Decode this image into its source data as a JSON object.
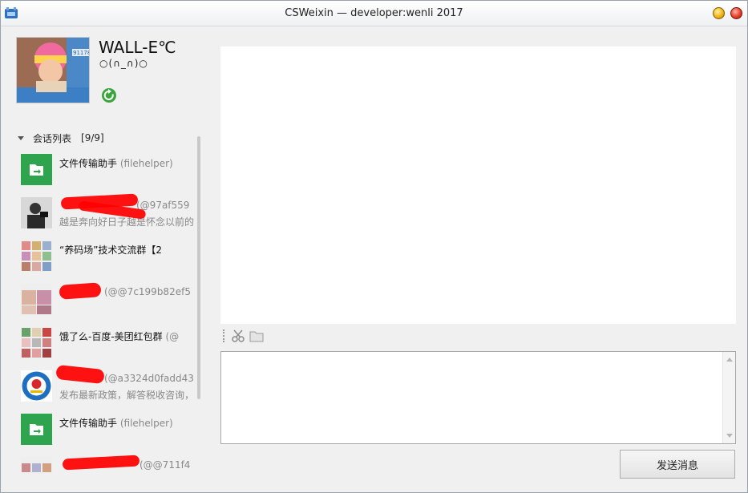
{
  "window": {
    "title": "CSWeixin — developer:wenli 2017",
    "icon": "app-logo-icon"
  },
  "profile": {
    "nickname": "WALL-E℃",
    "signature": "○(∩_∩)○",
    "avatar_text": "911787",
    "refresh_icon": "refresh-icon"
  },
  "session_list": {
    "label": "会话列表",
    "count": "[9/9]",
    "items": [
      {
        "name": "文件传输助手",
        "id": "(filehelper)",
        "message": "",
        "avatar_color": "#2ea44f",
        "icon": "file-transfer-icon"
      },
      {
        "name": "",
        "id": "(@97af559",
        "message": "越是奔向好日子越是怀念以前的",
        "avatar_color": "#555555",
        "icon": "contact-avatar"
      },
      {
        "name": "“养码场”技术交流群【2",
        "id": "",
        "message": "",
        "avatar_color": "#d9a8a0",
        "icon": "group-avatar"
      },
      {
        "name": "",
        "id": "(@@7c199b82ef5",
        "message": "",
        "avatar_color": "#caa8b4",
        "icon": "group-avatar"
      },
      {
        "name": "饿了么-百度-美团红包群",
        "id": "(@",
        "message": "",
        "avatar_color": "#c06060",
        "icon": "group-avatar"
      },
      {
        "name": "",
        "id": "(@a3324d0fadd43",
        "message": "发布最新政策，解答税收咨询，",
        "avatar_color": "#1e6fc0",
        "icon": "official-account-avatar"
      },
      {
        "name": "文件传输助手",
        "id": "(filehelper)",
        "message": "",
        "avatar_color": "#2ea44f",
        "icon": "file-transfer-icon"
      },
      {
        "name": "",
        "id": "(@@711f4",
        "message": "",
        "avatar_color": "#c88a8a",
        "icon": "group-avatar"
      }
    ]
  },
  "toolbar": {
    "screenshot_icon": "scissors-icon",
    "folder_icon": "folder-icon"
  },
  "input": {
    "value": ""
  },
  "send_button": {
    "label": "发送消息"
  },
  "colors": {
    "redaction": "#ff0000",
    "accent_green": "#2ea44f"
  }
}
